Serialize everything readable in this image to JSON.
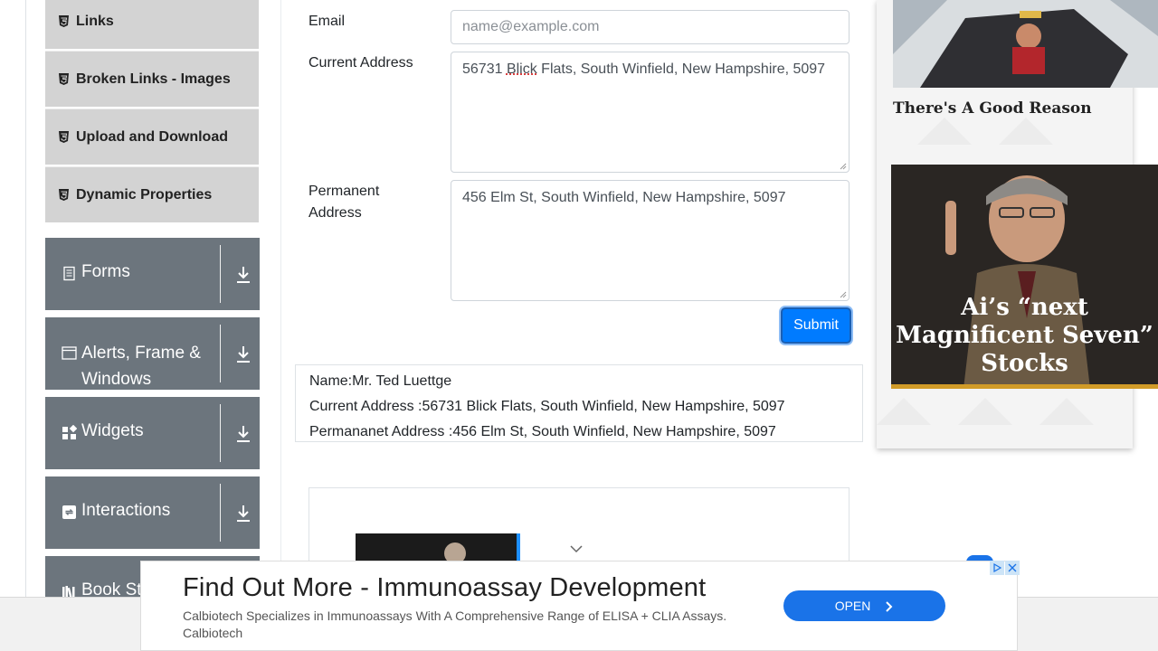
{
  "sidebar": {
    "sub_items": [
      {
        "label": "Links"
      },
      {
        "label": "Broken Links - Images"
      },
      {
        "label": "Upload and Download"
      },
      {
        "label": "Dynamic Properties"
      }
    ],
    "groups": [
      {
        "label": "Forms",
        "icon": "form-icon"
      },
      {
        "label": "Alerts, Frame & Windows",
        "icon": "window-icon"
      },
      {
        "label": "Widgets",
        "icon": "widgets-icon"
      },
      {
        "label": "Interactions",
        "icon": "interactions-icon"
      },
      {
        "label": "Book Store Application",
        "icon": "books-icon"
      }
    ]
  },
  "form": {
    "email_label": "Email",
    "email_placeholder": "name@example.com",
    "current_address_label": "Current Address",
    "current_address_value_word": "Blick",
    "current_address_value_pre": "56731 ",
    "current_address_value_post": " Flats, South Winfield, New Hampshire, 5097",
    "permanent_address_label": "Permanent Address",
    "permanent_address_value": "456 Elm St, South Winfield, New Hampshire, 5097",
    "submit_label": "Submit"
  },
  "output": {
    "name": "Name:Mr. Ted Luettge",
    "current_address": "Current Address :56731 Blick Flats, South Winfield, New Hampshire, 5097",
    "permanent_address": "Permananet Address :456 Elm St, South Winfield, New Hampshire, 5097"
  },
  "right_ads": {
    "reason_text": "There's A Good Reason",
    "promo_text": "Ai’s “next Magnificent Seven” Stocks"
  },
  "banner": {
    "title": "Find Out More - Immunoassay Development",
    "description": "Calbiotech Specializes in Immunoassays With A Comprehensive Range of ELISA + CLIA Assays. Calbiotech",
    "open_label": "OPEN"
  },
  "colors": {
    "group_bg": "#6c757d",
    "sub_item_bg": "#d3d3d3",
    "submit_bg": "#007bff",
    "open_bg": "#1a73e8"
  }
}
